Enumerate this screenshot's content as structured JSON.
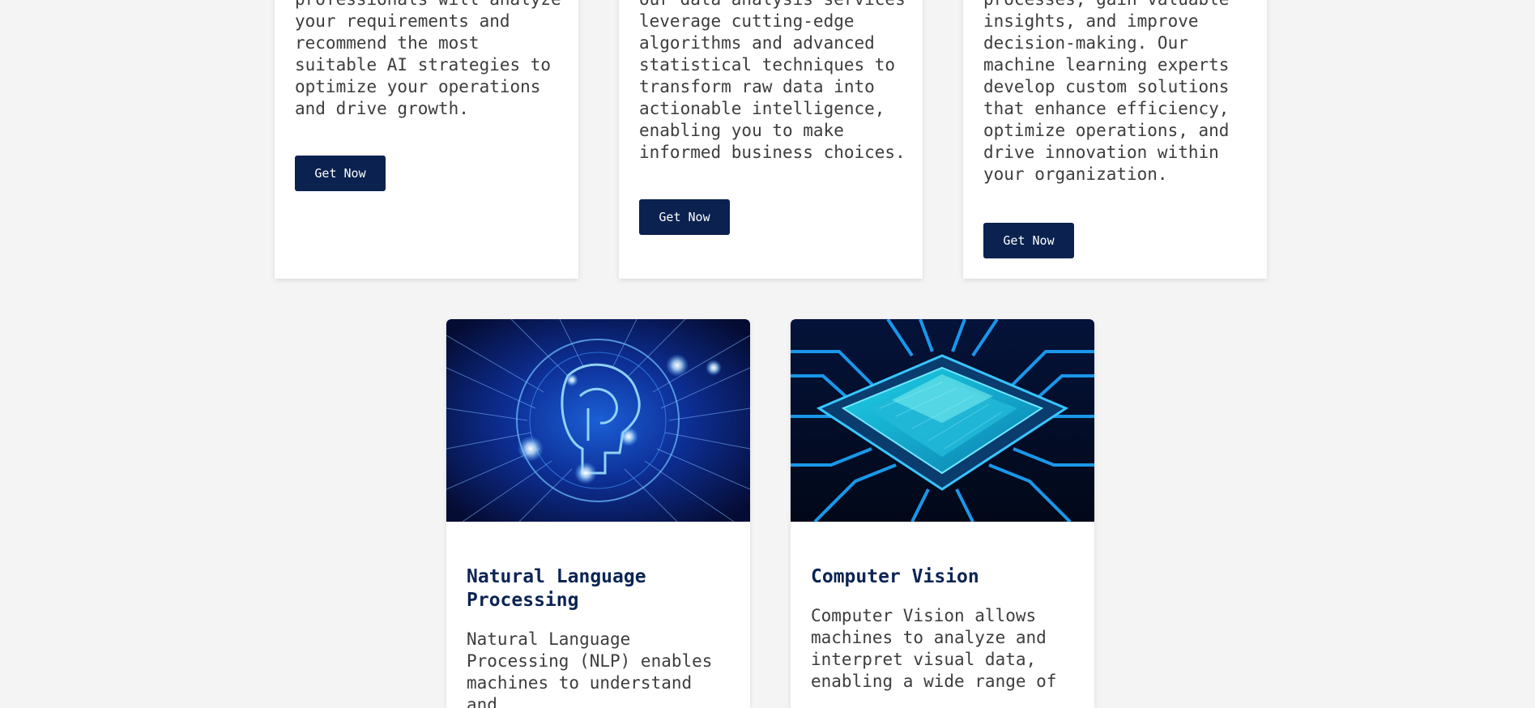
{
  "cards_top": [
    {
      "text_lines": "professionals will analyze\nyour requirements and\nrecommend the most\nsuitable AI strategies to\noptimize your operations\nand drive growth.",
      "button_label": "Get Now"
    },
    {
      "text_lines": "our data analysis services\nleverage cutting-edge\nalgorithms and advanced\nstatistical techniques to\ntransform raw data into\nactionable intelligence,\nenabling you to make\ninformed business choices.",
      "button_label": "Get Now"
    },
    {
      "text_lines": "processes, gain valuable\ninsights, and improve\ndecision-making. Our\nmachine learning experts\ndevelop custom solutions\nthat enhance efficiency,\noptimize operations, and\ndrive innovation within\nyour organization.",
      "button_label": "Get Now"
    }
  ],
  "cards_bottom": [
    {
      "image_icon": "brain-circuit-image",
      "title": "Natural Language\nProcessing",
      "text_lines": "Natural Language\nProcessing (NLP) enables\nmachines to understand and"
    },
    {
      "image_icon": "microchip-image",
      "title": "Computer Vision",
      "text_lines": "Computer Vision allows\nmachines to analyze and\ninterpret visual data,\nenabling a wide range of"
    }
  ],
  "colors": {
    "page_background": "#f4f4f4",
    "card_background": "#ffffff",
    "button_background": "#0b2150",
    "title_color": "#0b2454",
    "text_color": "#3d3d3d"
  }
}
